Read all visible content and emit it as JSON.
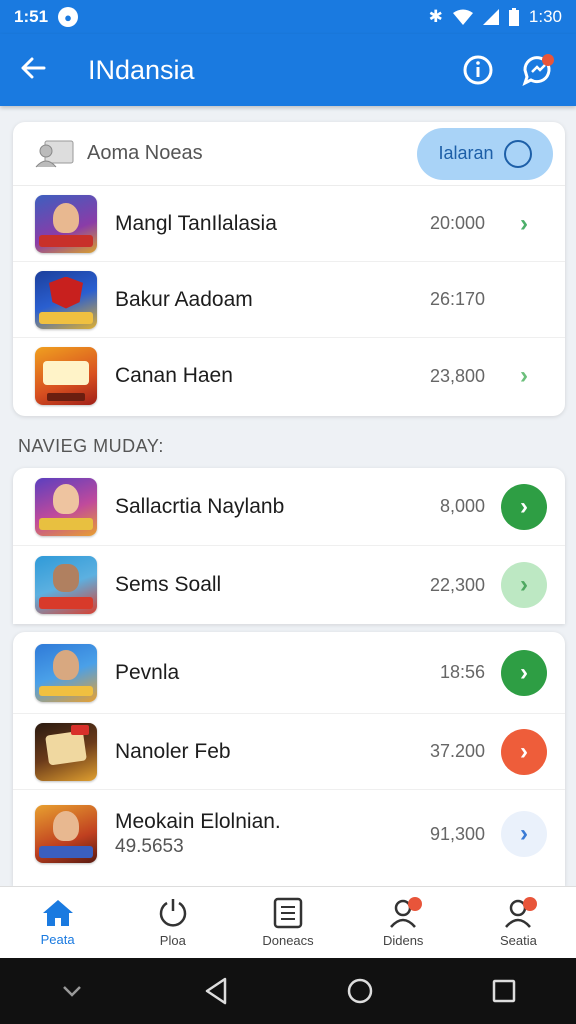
{
  "status_bar": {
    "time": "1:51",
    "right_time": "1:30"
  },
  "app_bar": {
    "title": "INdansia"
  },
  "top_card": {
    "header_label": "Aoma Noeas",
    "pill_label": "Ialaran",
    "rows": [
      {
        "name": "Mangl TanIlalasia",
        "value": "20:000"
      },
      {
        "name": "Bakur Aadoam",
        "value": "26:170"
      },
      {
        "name": "Canan Haen",
        "value": "23,800"
      }
    ]
  },
  "section": {
    "label": "NAVIEG MUDAY:"
  },
  "mid_card": {
    "rows": [
      {
        "name": "Sallacrtia Naylanb",
        "value": "8,000"
      },
      {
        "name": "Sems Soall",
        "value": "22,300"
      }
    ]
  },
  "bottom_card": {
    "rows": [
      {
        "name": "Pevnla",
        "value": "18:56"
      },
      {
        "name": "Nanoler Feb",
        "value": "37.200"
      },
      {
        "name": "Meokain Elolnian.",
        "sub": "49.5653",
        "value": "91,300"
      }
    ]
  },
  "bottom_nav": [
    {
      "label": "Peata"
    },
    {
      "label": "Ploa"
    },
    {
      "label": "Doneacs"
    },
    {
      "label": "Didens"
    },
    {
      "label": "Seatia"
    }
  ],
  "colors": {
    "primary": "#1a7ae0",
    "accent_green": "#2e9e44",
    "accent_orange": "#ee5d3a"
  }
}
